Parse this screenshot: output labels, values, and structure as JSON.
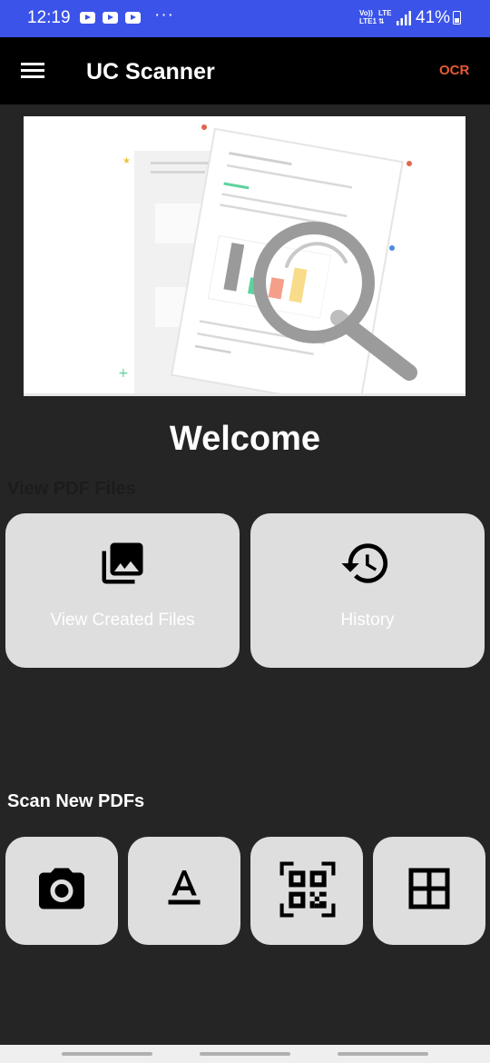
{
  "status_bar": {
    "time": "12:19",
    "overflow": "···",
    "network": [
      "Vo))",
      "LTE1"
    ],
    "lte": [
      "LTE",
      "⇅"
    ],
    "battery": "41%"
  },
  "app_bar": {
    "title": "UC Scanner",
    "ocr_label": "OCR"
  },
  "main": {
    "welcome": "Welcome",
    "view_section": {
      "title": "View PDF Files",
      "cards": [
        {
          "label": "View Created Files",
          "icon": "photo-library-icon"
        },
        {
          "label": "History",
          "icon": "history-icon"
        }
      ]
    },
    "scan_section": {
      "title": "Scan New PDFs",
      "buttons": [
        {
          "icon": "camera-icon"
        },
        {
          "icon": "text-format-icon"
        },
        {
          "icon": "qr-code-scan-icon"
        },
        {
          "icon": "grid-icon"
        }
      ]
    }
  },
  "colors": {
    "status_bar": "#3b53e8",
    "app_bar": "#000000",
    "background": "#252525",
    "card": "#dedede",
    "ocr": "#e65a33"
  }
}
